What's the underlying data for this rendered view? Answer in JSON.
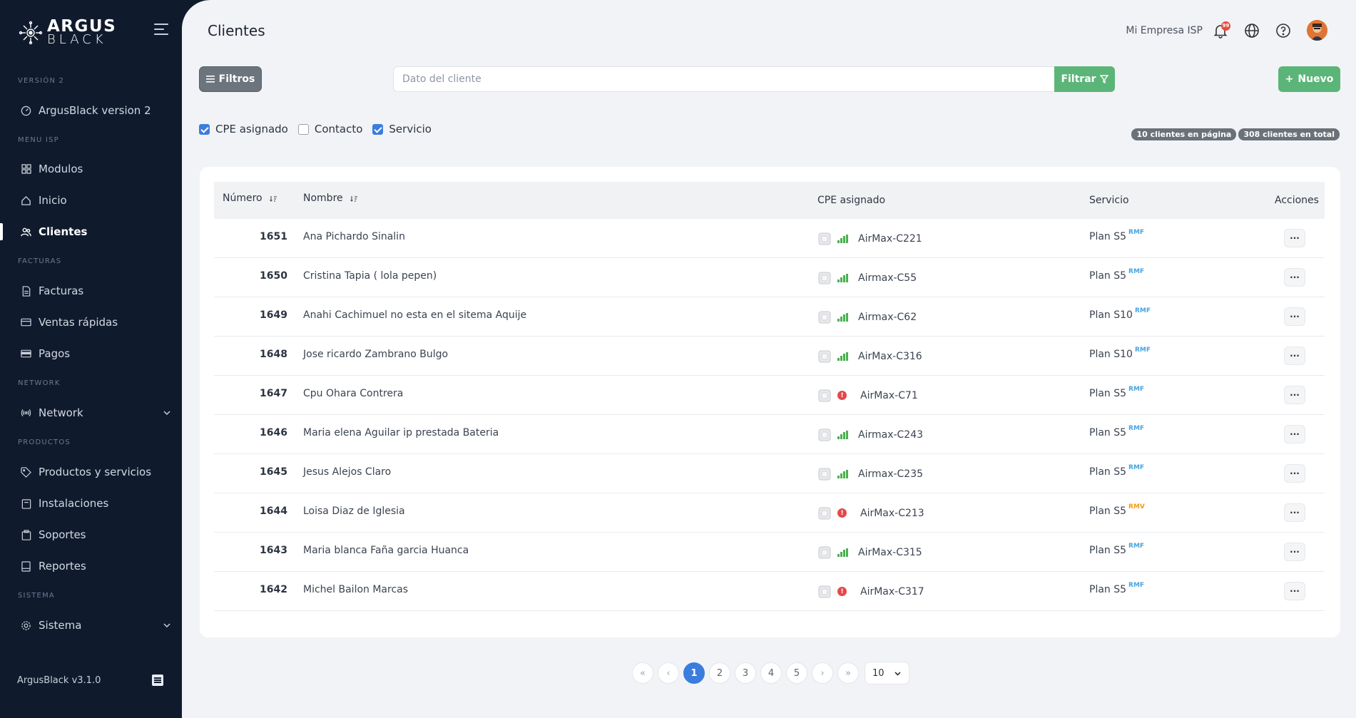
{
  "brand": {
    "line1": "ARGUS",
    "line2": "BLACK"
  },
  "sidebar": {
    "sections": [
      {
        "label": "VERSIÓN 2"
      },
      {
        "label": "MENU ISP"
      },
      {
        "label": "FACTURAS"
      },
      {
        "label": "NETWORK"
      },
      {
        "label": "PRODUCTOS"
      },
      {
        "label": "SISTEMA"
      }
    ],
    "items": [
      {
        "label": "ArgusBlack version 2",
        "icon": "dashboard-icon"
      },
      {
        "label": "Modulos",
        "icon": "grid-icon"
      },
      {
        "label": "Inicio",
        "icon": "home-icon"
      },
      {
        "label": "Clientes",
        "icon": "users-icon",
        "active": true
      },
      {
        "label": "Facturas",
        "icon": "document-icon"
      },
      {
        "label": "Ventas rápidas",
        "icon": "card-icon"
      },
      {
        "label": "Pagos",
        "icon": "wallet-icon"
      },
      {
        "label": "Network",
        "icon": "antenna-icon"
      },
      {
        "label": "Productos y servicios",
        "icon": "tag-icon"
      },
      {
        "label": "Instalaciones",
        "icon": "box-icon"
      },
      {
        "label": "Soportes",
        "icon": "clipboard-icon"
      },
      {
        "label": "Reportes",
        "icon": "report-icon"
      },
      {
        "label": "Sistema",
        "icon": "gear-icon"
      }
    ],
    "version_text": "ArgusBlack v3.1.0"
  },
  "header": {
    "title": "Clientes",
    "company": "Mi Empresa ISP",
    "notifications_count": "99"
  },
  "toolbar": {
    "filters_label": "Filtros",
    "search_placeholder": "Dato del cliente",
    "filter_button": "Filtrar",
    "new_button": "Nuevo"
  },
  "checkboxes": [
    {
      "label": "CPE asignado",
      "checked": true
    },
    {
      "label": "Contacto",
      "checked": false
    },
    {
      "label": "Servicio",
      "checked": true
    }
  ],
  "counts": {
    "per_page": "10 clientes en página",
    "total": "308 clientes en total"
  },
  "table": {
    "columns": [
      "Número",
      "Nombre",
      "CPE asignado",
      "Servicio",
      "Acciones"
    ],
    "action_label": "···",
    "rows": [
      {
        "number": "1651",
        "name": "Ana Pichardo Sinalin",
        "cpe": "AirMax-C221",
        "status": "signal",
        "service": "Plan S5",
        "tag": "RMF"
      },
      {
        "number": "1650",
        "name": "Cristina Tapia ( lola pepen)",
        "cpe": "Airmax-C55",
        "status": "signal",
        "service": "Plan S5",
        "tag": "RMF"
      },
      {
        "number": "1649",
        "name": "Anahi Cachimuel no esta en el sitema Aquije",
        "cpe": "Airmax-C62",
        "status": "signal",
        "service": "Plan S10",
        "tag": "RMF"
      },
      {
        "number": "1648",
        "name": "Jose ricardo Zambrano Bulgo",
        "cpe": "AirMax-C316",
        "status": "signal",
        "service": "Plan S10",
        "tag": "RMF"
      },
      {
        "number": "1647",
        "name": "Cpu Ohara Contrera",
        "cpe": "AirMax-C71",
        "status": "error",
        "service": "Plan S5",
        "tag": "RMF"
      },
      {
        "number": "1646",
        "name": "Maria elena Aguilar ip prestada Bateria",
        "cpe": "Airmax-C243",
        "status": "signal",
        "service": "Plan S5",
        "tag": "RMF"
      },
      {
        "number": "1645",
        "name": "Jesus Alejos Claro",
        "cpe": "Airmax-C235",
        "status": "signal",
        "service": "Plan S5",
        "tag": "RMF"
      },
      {
        "number": "1644",
        "name": "Loisa Diaz de Iglesia",
        "cpe": "AirMax-C213",
        "status": "error",
        "service": "Plan S5",
        "tag": "RMV"
      },
      {
        "number": "1643",
        "name": "Maria blanca Faña garcia Huanca",
        "cpe": "AirMax-C315",
        "status": "signal",
        "service": "Plan S5",
        "tag": "RMF"
      },
      {
        "number": "1642",
        "name": "Michel Bailon Marcas",
        "cpe": "AirMax-C317",
        "status": "error",
        "service": "Plan S5",
        "tag": "RMF"
      }
    ]
  },
  "pagination": {
    "first": "«",
    "prev": "‹",
    "next": "›",
    "last": "»",
    "pages": [
      "1",
      "2",
      "3",
      "4",
      "5"
    ],
    "current": "1",
    "per_page": "10"
  },
  "colors": {
    "sidebar_bg": "#0f1b2d",
    "accent_green": "#5cb578",
    "accent_blue": "#3b7ddd",
    "error_red": "#e54848"
  }
}
